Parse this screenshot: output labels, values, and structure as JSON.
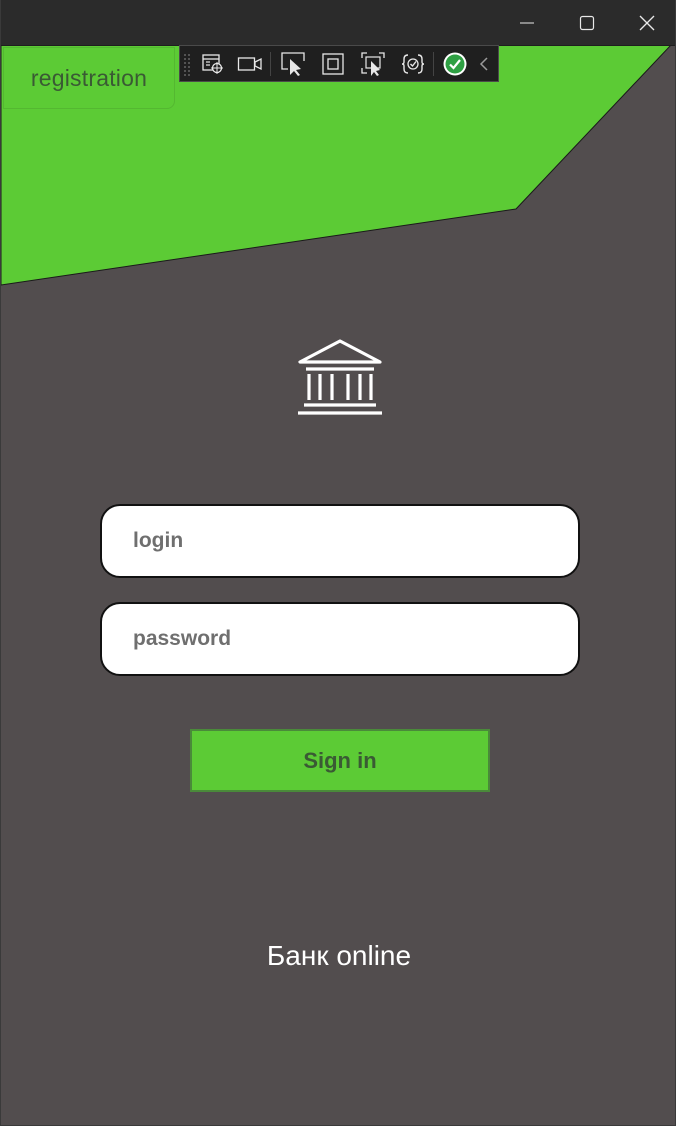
{
  "window": {
    "controls": {
      "minimize_icon": "minimize-icon",
      "maximize_icon": "maximize-icon",
      "close_icon": "close-icon"
    }
  },
  "header": {
    "registration_label": "registration",
    "accent_color": "#5ccb35"
  },
  "debug_toolbar": {
    "icons": [
      "live-visual-tree-icon",
      "record-icon",
      "select-element-icon",
      "display-layout-adorners-icon",
      "track-focus-icon",
      "binding-failures-icon",
      "hot-reload-ok-icon",
      "collapse-chevron-icon"
    ]
  },
  "main": {
    "logo_icon": "bank-building-icon",
    "login_placeholder": "login",
    "password_placeholder": "password",
    "signin_label": "Sign in",
    "footer_title": "Банк online"
  },
  "colors": {
    "background": "#524d4e",
    "green": "#5ccb35",
    "titlebar": "#2b2b2b"
  }
}
